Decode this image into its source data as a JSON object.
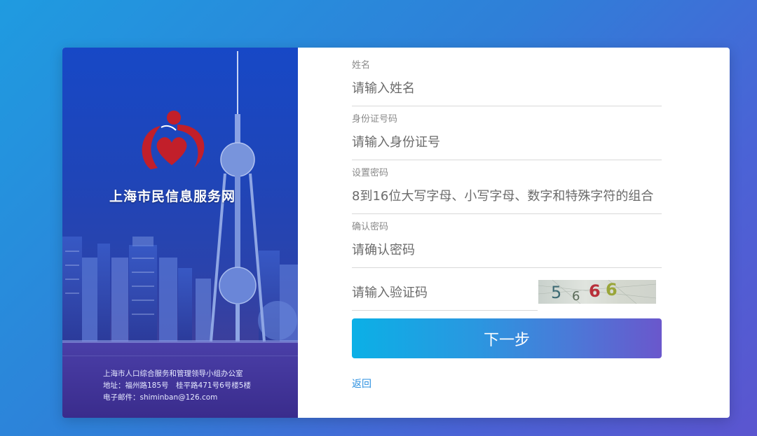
{
  "brand": {
    "site_name": "上海市民信息服务网"
  },
  "footer": {
    "org": "上海市人口综合服务和管理领导小组办公室",
    "address": "地址：福州路185号　桂平路471号6号楼5楼",
    "email": "电子邮件：shiminban@126.com"
  },
  "form": {
    "name": {
      "label": "姓名",
      "placeholder": "请输入姓名"
    },
    "id_number": {
      "label": "身份证号码",
      "placeholder": "请输入身份证号"
    },
    "password": {
      "label": "设置密码",
      "placeholder": "8到16位大写字母、小写字母、数字和特殊字符的组合"
    },
    "confirm_password": {
      "label": "确认密码",
      "placeholder": "请确认密码"
    },
    "captcha": {
      "placeholder": "请输入验证码",
      "code": "5666"
    }
  },
  "actions": {
    "next_label": "下一步",
    "back_label": "返回"
  },
  "colors": {
    "logo_red": "#c21f2a",
    "link_blue": "#2a8fe0"
  }
}
